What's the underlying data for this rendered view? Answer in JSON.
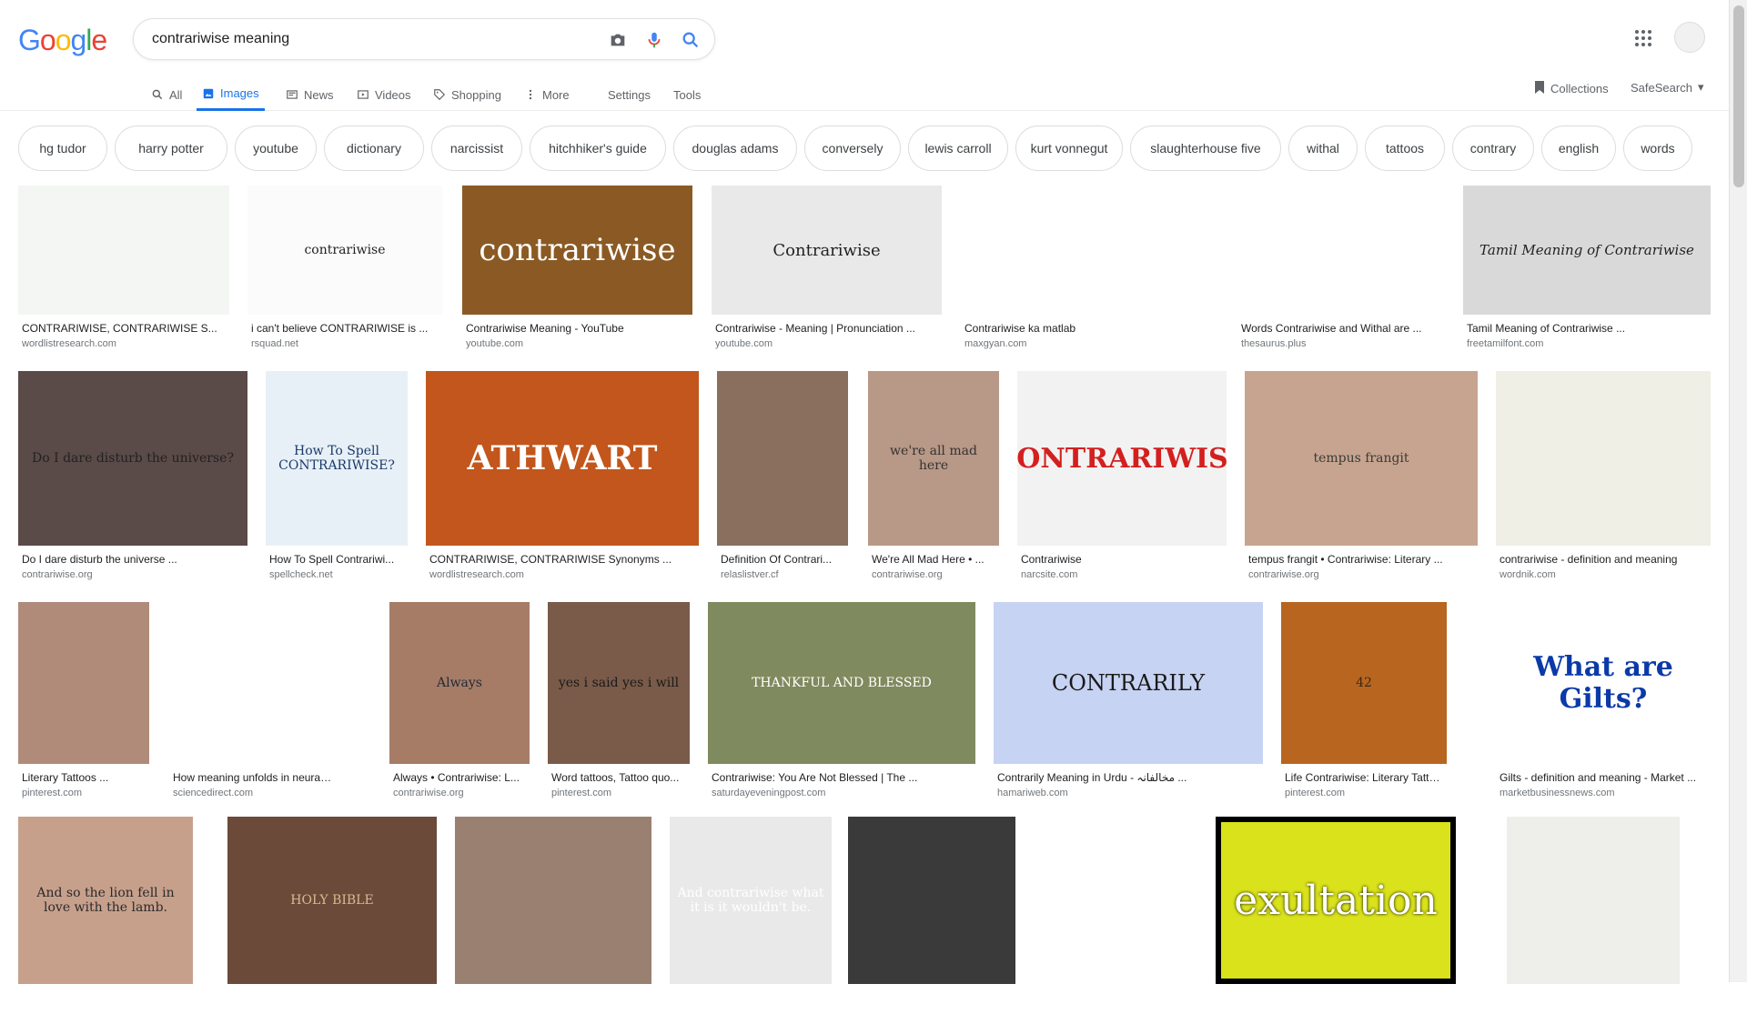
{
  "header": {
    "logo": [
      "G",
      "o",
      "o",
      "g",
      "l",
      "e"
    ],
    "search_value": "contrariwise meaning"
  },
  "tabs": [
    {
      "label": "All",
      "icon": "search-icon"
    },
    {
      "label": "Images",
      "icon": "image-icon",
      "active": true
    },
    {
      "label": "News",
      "icon": "news-icon"
    },
    {
      "label": "Videos",
      "icon": "video-icon"
    },
    {
      "label": "Shopping",
      "icon": "tag-icon"
    },
    {
      "label": "More",
      "icon": "more-icon"
    },
    {
      "label": "Settings"
    },
    {
      "label": "Tools"
    }
  ],
  "right_nav": {
    "collections": "Collections",
    "safesearch": "SafeSearch"
  },
  "chips": [
    "hg tudor",
    "harry potter",
    "youtube",
    "dictionary",
    "narcissist",
    "hitchhiker's guide",
    "douglas adams",
    "conversely",
    "lewis carroll",
    "kurt vonnegut",
    "slaughterhouse five",
    "withal",
    "tattoos",
    "contrary",
    "english",
    "words"
  ],
  "results": [
    {
      "title": "CONTRARIWISE, CONTRARIWISE S...",
      "source": "wordlistresearch.com",
      "bg": "#f4f6f3",
      "text": "",
      "fg": "#333"
    },
    {
      "title": "i can't believe CONTRARIWISE is ...",
      "source": "rsquad.net",
      "bg": "#fbfbfb",
      "text": "contrariwise",
      "fg": "#222"
    },
    {
      "title": "Contrariwise Meaning - YouTube",
      "source": "youtube.com",
      "bg": "#8b5a24",
      "text": "contrariwise",
      "fg": "#fff"
    },
    {
      "title": "Contrariwise - Meaning | Pronunciation ...",
      "source": "youtube.com",
      "bg": "#e9e9e9",
      "text": "Contrariwise",
      "fg": "#222"
    },
    {
      "title": "Contrariwise ka matlab",
      "source": "maxgyan.com",
      "bg": "#ffffff",
      "text": "",
      "fg": "#333"
    },
    {
      "title": "Words Contrariwise and Withal are ...",
      "source": "thesaurus.plus",
      "bg": "#ffffff",
      "text": "",
      "fg": "#333"
    },
    {
      "title": "Tamil Meaning of Contrariwise ...",
      "source": "freetamilfont.com",
      "bg": "#d9d9d9",
      "text": "Tamil Meaning of Contrariwise",
      "fg": "#222"
    },
    {
      "title": "Do I dare disturb the universe ...",
      "source": "contrariwise.org",
      "bg": "#5a4a48",
      "text": "Do I dare disturb the universe?",
      "fg": "#222"
    },
    {
      "title": "How To Spell Contrariwi...",
      "source": "spellcheck.net",
      "bg": "#e8f0f7",
      "text": "How To Spell CONTRARIWISE?",
      "fg": "#1a3a6a"
    },
    {
      "title": "CONTRARIWISE, CONTRARIWISE Synonyms ...",
      "source": "wordlistresearch.com",
      "bg": "#c2561c",
      "text": "ATHWART",
      "fg": "#fff"
    },
    {
      "title": "Definition Of Contrari...",
      "source": "relaslistver.cf",
      "bg": "#8a6f5e",
      "text": "",
      "fg": "#222"
    },
    {
      "title": "We're All Mad Here • ...",
      "source": "contrariwise.org",
      "bg": "#b89886",
      "text": "we're all mad here",
      "fg": "#333"
    },
    {
      "title": "Contrariwise",
      "source": "narcsite.com",
      "bg": "#f2f2f2",
      "text": "CONTRARIWISE",
      "fg": "#d41f1f"
    },
    {
      "title": "tempus frangit • Contrariwise: Literary ...",
      "source": "contrariwise.org",
      "bg": "#c7a48f",
      "text": "tempus frangit",
      "fg": "#3a3a3a"
    },
    {
      "title": "contrariwise - definition and meaning",
      "source": "wordnik.com",
      "bg": "#efefe6",
      "text": "",
      "fg": "#222"
    },
    {
      "title": "Literary Tattoos ...",
      "source": "pinterest.com",
      "bg": "#b08b7a",
      "text": "",
      "fg": "#222"
    },
    {
      "title": "How meaning unfolds in neural time ...",
      "source": "sciencedirect.com",
      "bg": "#ffffff",
      "text": "",
      "fg": "#222"
    },
    {
      "title": "Always • Contrariwise: L...",
      "source": "contrariwise.org",
      "bg": "#a67c66",
      "text": "Always",
      "fg": "#1f2a3a"
    },
    {
      "title": "Word tattoos, Tattoo quo...",
      "source": "pinterest.com",
      "bg": "#7a5a49",
      "text": "yes i said yes i will",
      "fg": "#1a1a1a"
    },
    {
      "title": "Contrariwise: You Are Not Blessed | The ...",
      "source": "saturdayeveningpost.com",
      "bg": "#7f8a5e",
      "text": "THANKFUL AND BLESSED",
      "fg": "#fff"
    },
    {
      "title": "Contrarily Meaning in Urdu - مخالفانہ ...",
      "source": "hamariweb.com",
      "bg": "#c7d3f2",
      "text": "CONTRARILY",
      "fg": "#1a1a1a"
    },
    {
      "title": "Life Contrariwise: Literary Tattoos ...",
      "source": "pinterest.com",
      "bg": "#b8661f",
      "text": "42",
      "fg": "#3a2a1a"
    },
    {
      "title": "Gilts - definition and meaning - Market ...",
      "source": "marketbusinessnews.com",
      "bg": "#ffffff",
      "text": "What are Gilts?",
      "fg": "#0b3aa8"
    },
    {
      "title": "",
      "source": "",
      "bg": "#c7a08c",
      "text": "And so the lion fell in love with the lamb.",
      "fg": "#2a2a2a"
    },
    {
      "title": "",
      "source": "",
      "bg": "#6b4a3a",
      "text": "HOLY BIBLE",
      "fg": "#d9b88f"
    },
    {
      "title": "",
      "source": "",
      "bg": "#9a8070",
      "text": "",
      "fg": "#222"
    },
    {
      "title": "",
      "source": "",
      "bg": "#e9e9e9",
      "text": "And contrariwise what it is it wouldn't be.",
      "fg": "#fff"
    },
    {
      "title": "",
      "source": "",
      "bg": "#3a3a3a",
      "text": "",
      "fg": "#fff"
    },
    {
      "title": "",
      "source": "",
      "bg": "#ffffff",
      "text": "",
      "fg": "#222"
    },
    {
      "title": "",
      "source": "",
      "bg": "#000000",
      "text": "exultation",
      "fg": "#fff"
    },
    {
      "title": "",
      "source": "",
      "bg": "#eeeeea",
      "text": "",
      "fg": "#222"
    }
  ],
  "colors": {
    "accent": "#1a73e8",
    "chip_border": "#dadce0",
    "caption": "#202124",
    "source": "#70757a"
  }
}
